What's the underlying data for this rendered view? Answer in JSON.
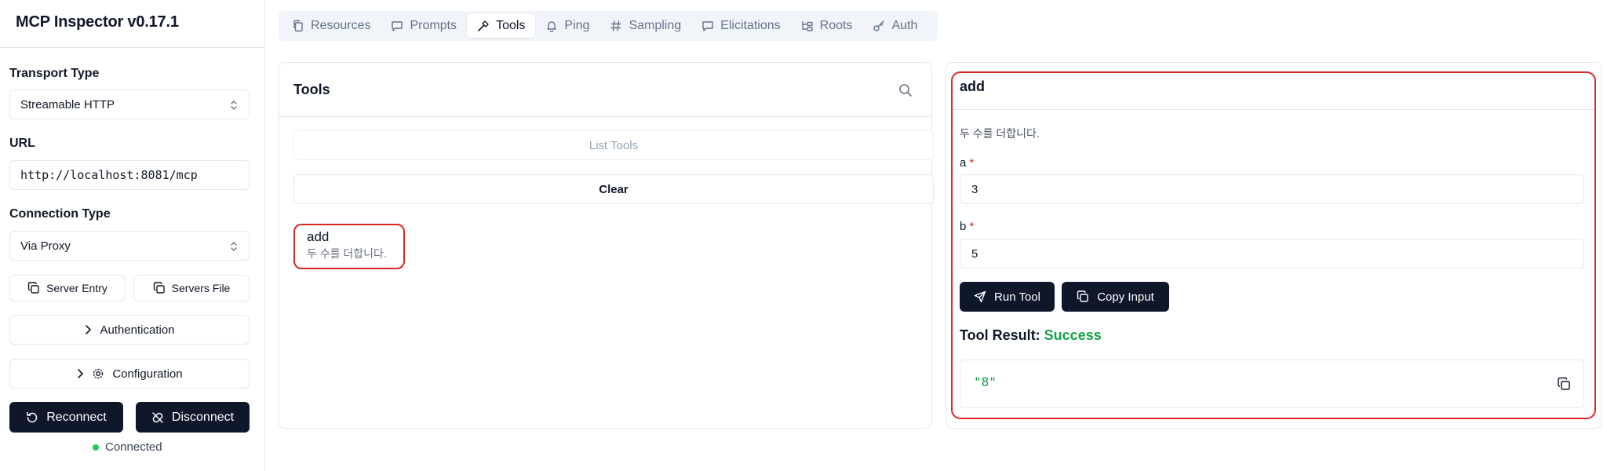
{
  "app": {
    "title": "MCP Inspector v0.17.1"
  },
  "sidebar": {
    "transport_label": "Transport Type",
    "transport_value": "Streamable HTTP",
    "url_label": "URL",
    "url_value": "http://localhost:8081/mcp",
    "connection_label": "Connection Type",
    "connection_value": "Via Proxy",
    "server_entry": "Server Entry",
    "servers_file": "Servers File",
    "authentication": "Authentication",
    "configuration": "Configuration",
    "reconnect": "Reconnect",
    "disconnect": "Disconnect",
    "status": "Connected",
    "status_color": "#22c55e"
  },
  "tabs": [
    {
      "label": "Resources",
      "icon": "files-icon",
      "active": false
    },
    {
      "label": "Prompts",
      "icon": "message-icon",
      "active": false
    },
    {
      "label": "Tools",
      "icon": "hammer-icon",
      "active": true
    },
    {
      "label": "Ping",
      "icon": "bell-icon",
      "active": false
    },
    {
      "label": "Sampling",
      "icon": "hash-icon",
      "active": false
    },
    {
      "label": "Elicitations",
      "icon": "message-icon",
      "active": false
    },
    {
      "label": "Roots",
      "icon": "folder-tree-icon",
      "active": false
    },
    {
      "label": "Auth",
      "icon": "key-icon",
      "active": false
    }
  ],
  "tools_panel": {
    "title": "Tools",
    "list_tools": "List Tools",
    "clear": "Clear",
    "items": [
      {
        "name": "add",
        "description": "두 수를 더합니다."
      }
    ]
  },
  "tool_detail": {
    "title": "add",
    "description": "두 수를 더합니다.",
    "params": [
      {
        "name": "a",
        "required_mark": "*",
        "value": "3"
      },
      {
        "name": "b",
        "required_mark": "*",
        "value": "5"
      }
    ],
    "run_tool": "Run Tool",
    "copy_input": "Copy Input",
    "result_label": "Tool Result:",
    "result_status": "Success",
    "result_value": "\"8\""
  },
  "colors": {
    "accent_dark": "#0f172a",
    "success": "#16a34a",
    "highlight": "#dc2626"
  }
}
